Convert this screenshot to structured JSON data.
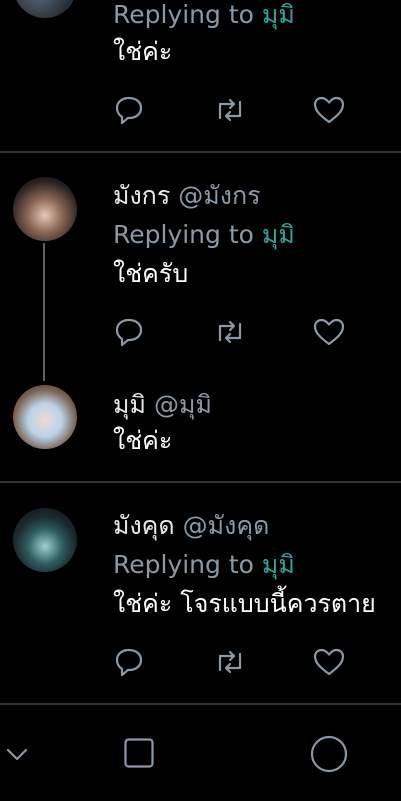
{
  "tweets": [
    {
      "replying_label": "Replying to",
      "replying_to": "มุมิ",
      "text": "ใช่ค่ะ"
    },
    {
      "display_name": "มังกร",
      "handle": "@มังกร",
      "replying_label": "Replying to",
      "replying_to": "มุมิ",
      "text": "ใช่ครับ"
    },
    {
      "display_name": "มุมิ",
      "handle": "@มุมิ",
      "text": "ใช่ค่ะ"
    },
    {
      "display_name": "มังคุด",
      "handle": "@มังคุด",
      "replying_label": "Replying to",
      "replying_to": "มุมิ",
      "text": "ใช่ค่ะ โจรแบบนี้ควรตาย"
    }
  ],
  "actions": {
    "reply_icon": "reply-icon",
    "retweet_icon": "retweet-icon",
    "like_icon": "heart-icon"
  },
  "navbar": {
    "back_icon": "chevron-down-icon",
    "recents_icon": "square-icon",
    "home_icon": "circle-icon"
  },
  "colors": {
    "background": "#000000",
    "text": "#ffffff",
    "secondary": "#8b98a5",
    "mention": "#2aa89a",
    "divider": "#2f3336"
  }
}
